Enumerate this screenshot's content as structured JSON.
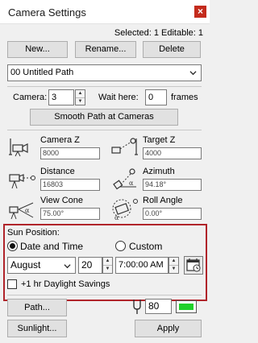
{
  "window": {
    "title": "Camera Settings",
    "close_glyph": "×"
  },
  "header": {
    "status": "Selected: 1 Editable: 1"
  },
  "toolbar": {
    "new_label": "New...",
    "rename_label": "Rename...",
    "delete_label": "Delete"
  },
  "path_select": {
    "value": "00  Untitled Path"
  },
  "camera": {
    "camera_label": "Camera:",
    "camera_value": "3",
    "wait_label": "Wait here:",
    "wait_value": "0",
    "frames_label": "frames"
  },
  "smooth_button_label": "Smooth Path at Cameras",
  "params": {
    "camera_z": {
      "label": "Camera Z",
      "value": "8000"
    },
    "target_z": {
      "label": "Target Z",
      "value": "4000"
    },
    "distance": {
      "label": "Distance",
      "value": "16803"
    },
    "azimuth": {
      "label": "Azimuth",
      "value": "94.18°"
    },
    "view_cone": {
      "label": "View Cone",
      "value": "75.00°"
    },
    "roll_angle": {
      "label": "Roll Angle",
      "value": "0.00°"
    }
  },
  "sun": {
    "title": "Sun Position:",
    "date_time_label": "Date and Time",
    "custom_label": "Custom",
    "selected": "Date and Time",
    "month": "August",
    "day": "20",
    "time": "7:00:00 AM"
  },
  "daylight_label": "+1 hr Daylight Savings",
  "daylight_checked": false,
  "bottom": {
    "path_label": "Path...",
    "sunlight_label": "Sunlight...",
    "apply_label": "Apply",
    "frames_value": "80",
    "toggle_on": true
  },
  "colors": {
    "highlight_border": "#b0242a",
    "toggle_green": "#1fd12a",
    "close_red": "#c42b1c"
  },
  "icons": [
    "camera-z-icon",
    "target-z-icon",
    "distance-icon",
    "azimuth-icon",
    "view-cone-icon",
    "roll-angle-icon",
    "calendar-icon",
    "tuning-fork-icon",
    "chevron-down-icon"
  ]
}
